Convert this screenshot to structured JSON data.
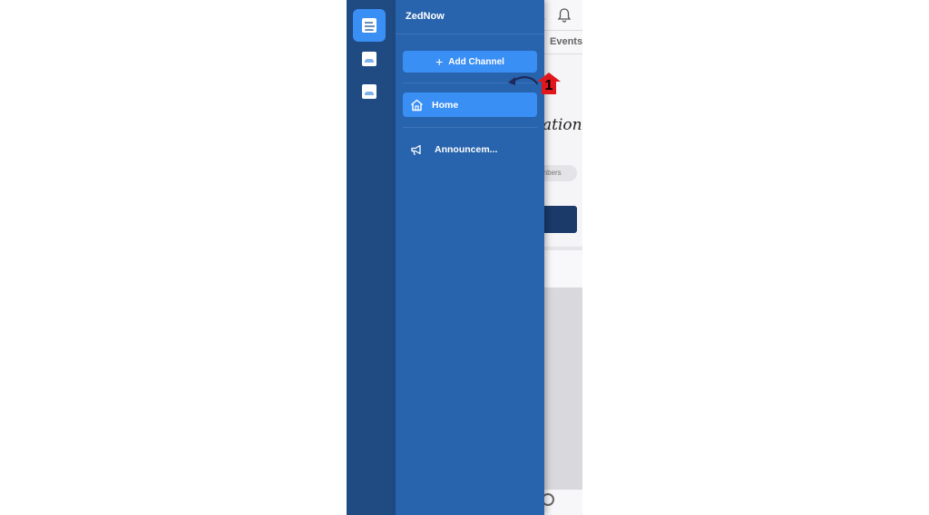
{
  "background_app": {
    "tab_label": "Events",
    "hero_text": "ation",
    "members_chip": "embers"
  },
  "server_rail": {
    "items": [
      {
        "name": "server-1",
        "active": true
      },
      {
        "name": "server-2",
        "active": false
      },
      {
        "name": "server-3",
        "active": false
      }
    ]
  },
  "drawer": {
    "title": "ZedNow",
    "add_channel_label": "Add Channel",
    "channels": [
      {
        "label": "Home",
        "icon": "home-icon",
        "selected": true
      },
      {
        "label": "Announcem...",
        "icon": "megaphone-icon",
        "selected": false
      }
    ]
  },
  "annotation": {
    "step_number": "1"
  },
  "colors": {
    "rail": "#1f4a82",
    "drawer": "#2863ad",
    "accent": "#3a8ff5",
    "marker": "#e0161c"
  }
}
